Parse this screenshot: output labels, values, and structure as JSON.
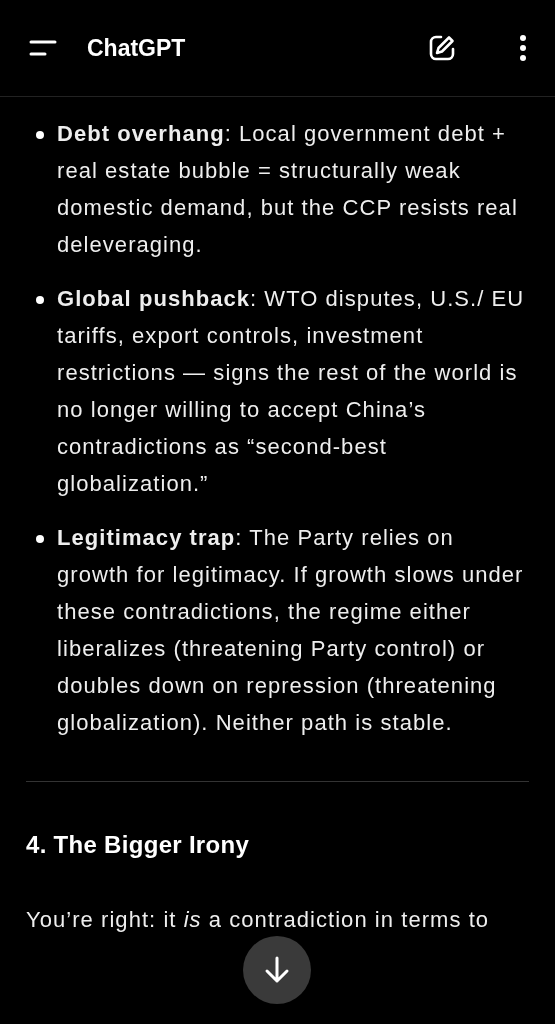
{
  "header": {
    "title": "ChatGPT"
  },
  "bullets": [
    {
      "text": "**Debt overhang**: Local government debt + real estate bubble = structurally weak domestic demand, but the CCP resists real deleveraging."
    },
    {
      "text": "**Global pushback**: WTO disputes, U.S./ EU tariffs, export controls, investment restrictions — signs the rest of the world is no longer willing to accept China’s contradictions as “second-best globalization.”"
    },
    {
      "text": "**Legitimacy trap**: The Party relies on growth for legitimacy. If growth slows under these contradictions, the regime either liberalizes (threatening Party control) or doubles down on repression (threatening globalization). Neither path is stable."
    }
  ],
  "heading": "4. The Bigger Irony",
  "paragraph": "You’re right: it *is* a contradiction in terms to"
}
